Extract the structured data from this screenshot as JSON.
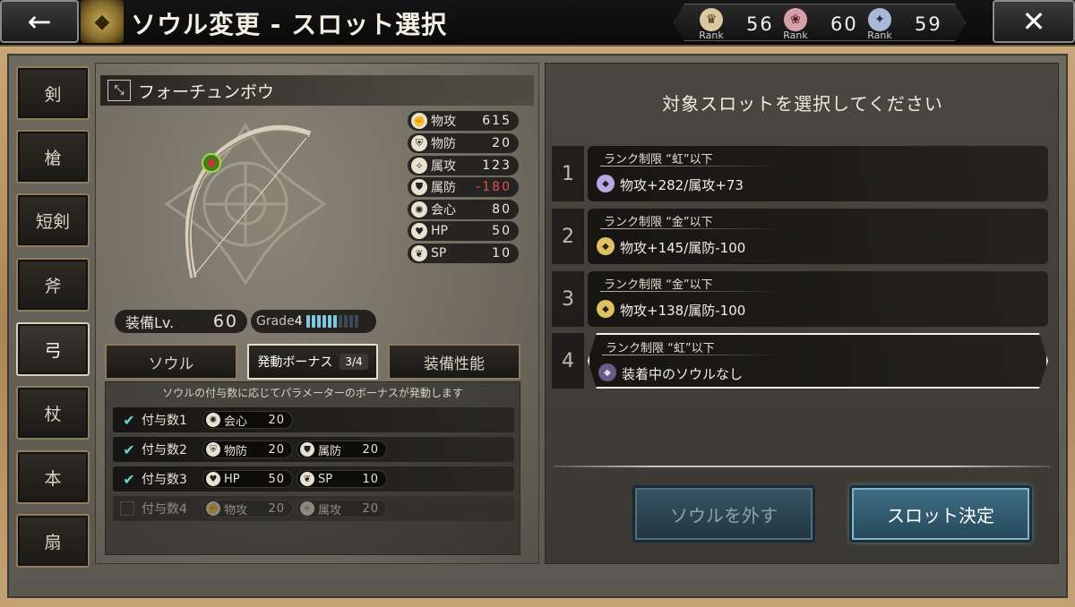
{
  "header": {
    "title": "ソウル変更 - スロット選択",
    "back_icon": "←",
    "close_icon": "✕",
    "ranks": [
      {
        "label": "Rank",
        "value": "56",
        "color": "#d9c8a0"
      },
      {
        "label": "Rank",
        "value": "60",
        "color": "#d6a0a8"
      },
      {
        "label": "Rank",
        "value": "59",
        "color": "#a8b8d8"
      }
    ]
  },
  "side_tabs": [
    {
      "label": "剣",
      "active": false
    },
    {
      "label": "槍",
      "active": false
    },
    {
      "label": "短剣",
      "active": false
    },
    {
      "label": "斧",
      "active": false
    },
    {
      "label": "弓",
      "active": true
    },
    {
      "label": "杖",
      "active": false
    },
    {
      "label": "本",
      "active": false
    },
    {
      "label": "扇",
      "active": false
    }
  ],
  "weapon": {
    "name": "フォーチュンボウ",
    "type_icon": "bow-icon",
    "stats": [
      {
        "icon": "phys-attack-icon",
        "label": "物攻",
        "value": "615",
        "negative": false
      },
      {
        "icon": "phys-defense-icon",
        "label": "物防",
        "value": "20",
        "negative": false
      },
      {
        "icon": "elem-attack-icon",
        "label": "属攻",
        "value": "123",
        "negative": false
      },
      {
        "icon": "elem-defense-icon",
        "label": "属防",
        "value": "-180",
        "negative": true
      },
      {
        "icon": "critical-icon",
        "label": "会心",
        "value": "80",
        "negative": false
      },
      {
        "icon": "heart-icon",
        "label": "HP",
        "value": "50",
        "negative": false
      },
      {
        "icon": "sp-icon",
        "label": "SP",
        "value": "10",
        "negative": false
      }
    ],
    "equip_level_label": "装備Lv.",
    "equip_level": "60",
    "grade_label": "Grade",
    "grade": "4",
    "grade_fill": 0.6
  },
  "sub_tabs": {
    "soul": "ソウル",
    "bonus": "発動ボーナス",
    "bonus_count": "3/4",
    "performance": "装備性能"
  },
  "bonus": {
    "caption": "ソウルの付与数に応じてパラメーターのボーナスが発動します",
    "rows": [
      {
        "label": "付与数1",
        "checked": true,
        "pills": [
          {
            "label": "会心",
            "value": "20"
          }
        ]
      },
      {
        "label": "付与数2",
        "checked": true,
        "pills": [
          {
            "label": "物防",
            "value": "20"
          },
          {
            "label": "属防",
            "value": "20"
          }
        ]
      },
      {
        "label": "付与数3",
        "checked": true,
        "pills": [
          {
            "label": "HP",
            "value": "50"
          },
          {
            "label": "SP",
            "value": "10"
          }
        ]
      },
      {
        "label": "付与数4",
        "checked": false,
        "pills": [
          {
            "label": "物攻",
            "value": "20"
          },
          {
            "label": "属攻",
            "value": "20"
          }
        ]
      }
    ]
  },
  "slots": {
    "title": "対象スロットを選択してください",
    "items": [
      {
        "num": "1",
        "limit": "ランク制限 “虹”以下",
        "text": "物攻+282/属攻+73",
        "gem_color": "#b8a8e0",
        "selected": false
      },
      {
        "num": "2",
        "limit": "ランク制限 “金”以下",
        "text": "物攻+145/属防-100",
        "gem_color": "#e0c060",
        "selected": false
      },
      {
        "num": "3",
        "limit": "ランク制限 “金”以下",
        "text": "物攻+138/属防-100",
        "gem_color": "#e0c060",
        "selected": false
      },
      {
        "num": "4",
        "limit": "ランク制限 “虹”以下",
        "text": "装着中のソウルなし",
        "gem_color": "#6a5a8a",
        "selected": true
      }
    ]
  },
  "buttons": {
    "remove": "ソウルを外す",
    "confirm": "スロット決定"
  }
}
